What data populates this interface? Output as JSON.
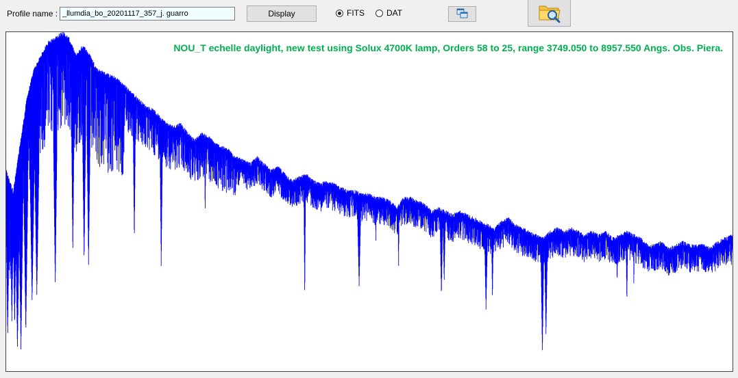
{
  "toolbar": {
    "profile_label": "Profile name :",
    "profile_value": "_llumdia_bo_20201117_357_j. guarro",
    "display_label": "Display",
    "format_options": [
      "FITS",
      "DAT"
    ],
    "selected_format": "FITS",
    "copy_icon": "copy-window-icon",
    "open_icon": "folder-search-icon"
  },
  "colors": {
    "spectrum_line": "#0000ff",
    "title_text": "#00b050",
    "background": "#f0f0f0"
  },
  "chart_data": {
    "type": "line",
    "title": "NOU_T echelle daylight, new test using Solux 4700K lamp, Orders 58 to 25, range 3749.050 to 8957.550 Angs. Obs. Piera.",
    "xlim": [
      3749.05,
      8957.55
    ],
    "ylim": [
      0,
      1
    ],
    "xlabel": "",
    "ylabel": "",
    "grid": false,
    "legend": "none",
    "axes_visible": false,
    "series": [
      {
        "values": [
          [
            3749,
            0.58
          ],
          [
            3800,
            0.52
          ],
          [
            3850,
            0.66
          ],
          [
            3900,
            0.8
          ],
          [
            3950,
            0.88
          ],
          [
            4000,
            0.92
          ],
          [
            4050,
            0.96
          ],
          [
            4100,
            0.97
          ],
          [
            4150,
            0.99
          ],
          [
            4200,
            0.97
          ],
          [
            4250,
            0.92
          ],
          [
            4300,
            0.95
          ],
          [
            4350,
            0.92
          ],
          [
            4400,
            0.88
          ],
          [
            4450,
            0.87
          ],
          [
            4500,
            0.86
          ],
          [
            4550,
            0.85
          ],
          [
            4600,
            0.83
          ],
          [
            4650,
            0.81
          ],
          [
            4700,
            0.79
          ],
          [
            4750,
            0.77
          ],
          [
            4800,
            0.76
          ],
          [
            4850,
            0.74
          ],
          [
            4900,
            0.72
          ],
          [
            4950,
            0.71
          ],
          [
            5000,
            0.72
          ],
          [
            5050,
            0.69
          ],
          [
            5100,
            0.67
          ],
          [
            5150,
            0.69
          ],
          [
            5200,
            0.68
          ],
          [
            5250,
            0.66
          ],
          [
            5300,
            0.65
          ],
          [
            5350,
            0.64
          ],
          [
            5400,
            0.62
          ],
          [
            5450,
            0.61
          ],
          [
            5500,
            0.6
          ],
          [
            5550,
            0.62
          ],
          [
            5600,
            0.6
          ],
          [
            5650,
            0.58
          ],
          [
            5700,
            0.59
          ],
          [
            5750,
            0.57
          ],
          [
            5800,
            0.55
          ],
          [
            5850,
            0.56
          ],
          [
            5900,
            0.57
          ],
          [
            5950,
            0.55
          ],
          [
            6000,
            0.54
          ],
          [
            6050,
            0.55
          ],
          [
            6100,
            0.54
          ],
          [
            6150,
            0.53
          ],
          [
            6200,
            0.52
          ],
          [
            6250,
            0.52
          ],
          [
            6300,
            0.51
          ],
          [
            6350,
            0.51
          ],
          [
            6400,
            0.5
          ],
          [
            6450,
            0.5
          ],
          [
            6500,
            0.49
          ],
          [
            6550,
            0.47
          ],
          [
            6600,
            0.5
          ],
          [
            6650,
            0.5
          ],
          [
            6700,
            0.49
          ],
          [
            6750,
            0.48
          ],
          [
            6800,
            0.46
          ],
          [
            6850,
            0.47
          ],
          [
            6900,
            0.46
          ],
          [
            6950,
            0.45
          ],
          [
            7000,
            0.46
          ],
          [
            7050,
            0.45
          ],
          [
            7100,
            0.44
          ],
          [
            7150,
            0.43
          ],
          [
            7200,
            0.42
          ],
          [
            7250,
            0.41
          ],
          [
            7300,
            0.43
          ],
          [
            7350,
            0.44
          ],
          [
            7400,
            0.42
          ],
          [
            7450,
            0.41
          ],
          [
            7500,
            0.4
          ],
          [
            7550,
            0.39
          ],
          [
            7600,
            0.38
          ],
          [
            7650,
            0.4
          ],
          [
            7700,
            0.41
          ],
          [
            7750,
            0.4
          ],
          [
            7800,
            0.41
          ],
          [
            7850,
            0.4
          ],
          [
            7900,
            0.39
          ],
          [
            7950,
            0.4
          ],
          [
            8000,
            0.39
          ],
          [
            8050,
            0.4
          ],
          [
            8100,
            0.38
          ],
          [
            8150,
            0.39
          ],
          [
            8200,
            0.4
          ],
          [
            8250,
            0.39
          ],
          [
            8300,
            0.38
          ],
          [
            8350,
            0.36
          ],
          [
            8400,
            0.36
          ],
          [
            8450,
            0.37
          ],
          [
            8500,
            0.35
          ],
          [
            8550,
            0.36
          ],
          [
            8600,
            0.37
          ],
          [
            8650,
            0.36
          ],
          [
            8700,
            0.36
          ],
          [
            8750,
            0.36
          ],
          [
            8800,
            0.35
          ],
          [
            8850,
            0.37
          ],
          [
            8900,
            0.38
          ],
          [
            8957,
            0.39
          ]
        ]
      }
    ],
    "absorption_features": [
      {
        "x": 3760,
        "min": 0.1,
        "width": 14
      },
      {
        "x": 3790,
        "min": 0.14,
        "width": 14
      },
      {
        "x": 3810,
        "min": 0.13,
        "width": 14
      },
      {
        "x": 3830,
        "min": 0.06,
        "width": 14
      },
      {
        "x": 3855,
        "min": 0.06,
        "width": 14
      },
      {
        "x": 3890,
        "min": 0.11,
        "width": 14
      },
      {
        "x": 3935,
        "min": 0.2,
        "width": 16
      },
      {
        "x": 3969,
        "min": 0.22,
        "width": 16
      },
      {
        "x": 4101,
        "min": 0.25,
        "width": 12
      },
      {
        "x": 4227,
        "min": 0.34,
        "width": 10
      },
      {
        "x": 4308,
        "min": 0.32,
        "width": 12
      },
      {
        "x": 4340,
        "min": 0.31,
        "width": 12
      },
      {
        "x": 4668,
        "min": 0.38,
        "width": 10
      },
      {
        "x": 4861,
        "min": 0.3,
        "width": 10
      },
      {
        "x": 5176,
        "min": 0.46,
        "width": 10
      },
      {
        "x": 5890,
        "min": 0.21,
        "width": 8
      },
      {
        "x": 6280,
        "min": 0.25,
        "width": 22
      },
      {
        "x": 6400,
        "min": 0.36,
        "width": 8
      },
      {
        "x": 6563,
        "min": 0.3,
        "width": 10
      },
      {
        "x": 6870,
        "min": 0.22,
        "width": 18
      },
      {
        "x": 6890,
        "min": 0.26,
        "width": 18
      },
      {
        "x": 7190,
        "min": 0.18,
        "width": 20
      },
      {
        "x": 7236,
        "min": 0.21,
        "width": 14
      },
      {
        "x": 7400,
        "min": 0.36,
        "width": 8
      },
      {
        "x": 7594,
        "min": 0.05,
        "width": 14
      },
      {
        "x": 7620,
        "min": 0.1,
        "width": 16
      },
      {
        "x": 8130,
        "min": 0.26,
        "width": 18
      },
      {
        "x": 8200,
        "min": 0.2,
        "width": 14
      },
      {
        "x": 8250,
        "min": 0.24,
        "width": 10
      },
      {
        "x": 8400,
        "min": 0.33,
        "width": 10
      },
      {
        "x": 8498,
        "min": 0.29,
        "width": 10
      },
      {
        "x": 8542,
        "min": 0.28,
        "width": 10
      },
      {
        "x": 8662,
        "min": 0.3,
        "width": 10
      },
      {
        "x": 8950,
        "min": 0.29,
        "width": 10
      }
    ]
  }
}
